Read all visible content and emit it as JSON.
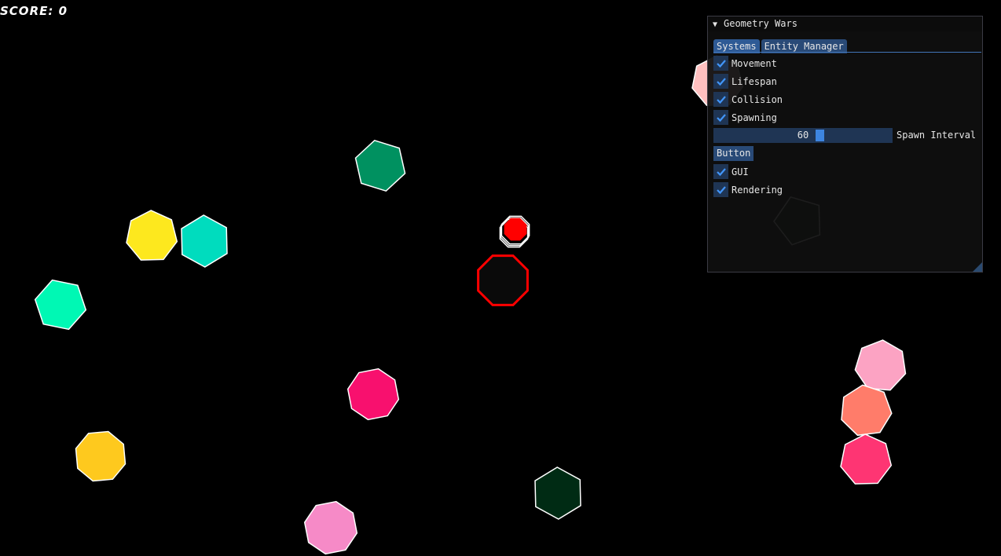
{
  "hud": {
    "score_text": "SCORE: 0"
  },
  "panel": {
    "title": "Geometry Wars",
    "collapse_icon": "triangle-down-icon",
    "tabs": [
      {
        "label": "Systems",
        "active": true
      },
      {
        "label": "Entity Manager",
        "active": false
      }
    ],
    "systems": {
      "movement": {
        "label": "Movement",
        "checked": true
      },
      "lifespan": {
        "label": "Lifespan",
        "checked": true
      },
      "collision": {
        "label": "Collision",
        "checked": true
      },
      "spawning": {
        "label": "Spawning",
        "checked": true
      },
      "spawn_interval": {
        "label": "Spawn Interval",
        "value": "60",
        "fraction": 0.6
      },
      "button_label": "Button",
      "gui": {
        "label": "GUI",
        "checked": true
      },
      "rendering": {
        "label": "Rendering",
        "checked": true
      }
    }
  },
  "colors": {
    "background": "#000000",
    "player_outline": "#ff0000",
    "bullet": "#ff0000",
    "panel_accent": "#3d85e0",
    "check": "#4296fa"
  },
  "enemies": [
    {
      "color": "#009160",
      "sides": 6
    },
    {
      "color": "#fde81e",
      "sides": 7
    },
    {
      "color": "#00dcbe",
      "sides": 6
    },
    {
      "color": "#00f8b4",
      "sides": 6
    },
    {
      "color": "#f8106e",
      "sides": 8
    },
    {
      "color": "#fec91e",
      "sides": 8
    },
    {
      "color": "#f68ac7",
      "sides": 8
    },
    {
      "color": "#002b14",
      "sides": 6
    },
    {
      "color": "#fca3c3",
      "sides": 7
    },
    {
      "color": "#ff7c6a",
      "sides": 7
    },
    {
      "color": "#fe3573",
      "sides": 7
    },
    {
      "color": "#ffc0c0",
      "sides": 7
    },
    {
      "color": "#0e1a0e",
      "sides": 5
    }
  ]
}
